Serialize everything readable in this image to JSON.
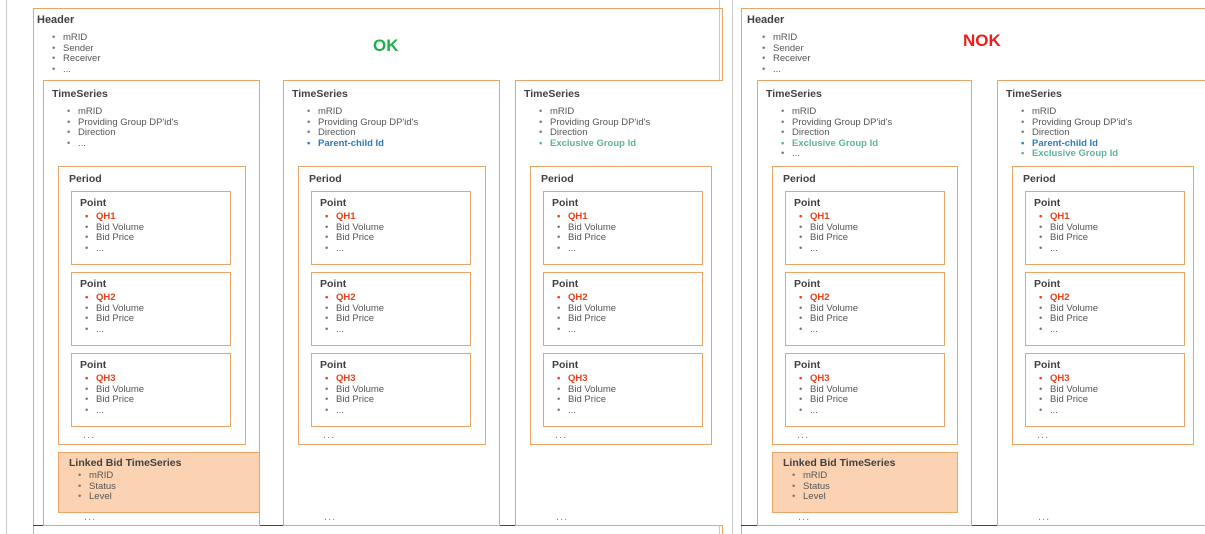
{
  "left": {
    "status": "OK",
    "status_color": "#1db04a",
    "header": {
      "title": "Header",
      "items": [
        "mRID",
        "Sender",
        "Receiver",
        "..."
      ]
    },
    "ts1": {
      "title": "TimeSeries",
      "items": [
        "mRID",
        "Providing Group DP'id's",
        "Direction",
        "..."
      ],
      "period_title": "Period",
      "points": [
        {
          "title": "Point",
          "items": [
            "QH1",
            "Bid Volume",
            "Bid Price",
            "..."
          ]
        },
        {
          "title": "Point",
          "items": [
            "QH2",
            "Bid Volume",
            "Bid Price",
            "..."
          ]
        },
        {
          "title": "Point",
          "items": [
            "QH3",
            "Bid Volume",
            "Bid Price",
            "..."
          ]
        }
      ],
      "points_more": "...",
      "linked": {
        "title": "Linked Bid TimeSeries",
        "items": [
          "mRID",
          "Status",
          "Level"
        ]
      },
      "more": "..."
    },
    "ts2": {
      "title": "TimeSeries",
      "items": [
        "mRID",
        "Providing Group DP'id's",
        "Direction",
        "Parent-child Id"
      ],
      "period_title": "Period",
      "points": [
        {
          "title": "Point",
          "items": [
            "QH1",
            "Bid Volume",
            "Bid Price",
            "..."
          ]
        },
        {
          "title": "Point",
          "items": [
            "QH2",
            "Bid Volume",
            "Bid Price",
            "..."
          ]
        },
        {
          "title": "Point",
          "items": [
            "QH3",
            "Bid Volume",
            "Bid Price",
            "..."
          ]
        }
      ],
      "points_more": "...",
      "more": "..."
    },
    "ts3": {
      "title": "TimeSeries",
      "items": [
        "mRID",
        "Providing Group DP'id's",
        "Direction",
        "Exclusive Group Id"
      ],
      "period_title": "Period",
      "points": [
        {
          "title": "Point",
          "items": [
            "QH1",
            "Bid Volume",
            "Bid Price",
            "..."
          ]
        },
        {
          "title": "Point",
          "items": [
            "QH2",
            "Bid Volume",
            "Bid Price",
            "..."
          ]
        },
        {
          "title": "Point",
          "items": [
            "QH3",
            "Bid Volume",
            "Bid Price",
            "..."
          ]
        }
      ],
      "points_more": "...",
      "more": "..."
    }
  },
  "right": {
    "status": "NOK",
    "status_color": "#ee1c1c",
    "header": {
      "title": "Header",
      "items": [
        "mRID",
        "Sender",
        "Receiver",
        "..."
      ]
    },
    "ts1": {
      "title": "TimeSeries",
      "items": [
        "mRID",
        "Providing Group DP'id's",
        "Direction",
        "Exclusive Group Id",
        "..."
      ],
      "period_title": "Period",
      "points": [
        {
          "title": "Point",
          "items": [
            "QH1",
            "Bid Volume",
            "Bid Price",
            "..."
          ]
        },
        {
          "title": "Point",
          "items": [
            "QH2",
            "Bid Volume",
            "Bid Price",
            "..."
          ]
        },
        {
          "title": "Point",
          "items": [
            "QH3",
            "Bid Volume",
            "Bid Price",
            "..."
          ]
        }
      ],
      "points_more": "...",
      "linked": {
        "title": "Linked Bid TimeSeries",
        "items": [
          "mRID",
          "Status",
          "Level"
        ]
      },
      "more": "..."
    },
    "ts2": {
      "title": "TimeSeries",
      "items": [
        "mRID",
        "Providing Group DP'id's",
        "Direction",
        "Parent-child Id",
        "Exclusive Group Id"
      ],
      "period_title": "Period",
      "points": [
        {
          "title": "Point",
          "items": [
            "QH1",
            "Bid Volume",
            "Bid Price",
            "..."
          ]
        },
        {
          "title": "Point",
          "items": [
            "QH2",
            "Bid Volume",
            "Bid Price",
            "..."
          ]
        },
        {
          "title": "Point",
          "items": [
            "QH3",
            "Bid Volume",
            "Bid Price",
            "..."
          ]
        }
      ],
      "points_more": "...",
      "more": "..."
    }
  },
  "colors": {
    "orange_border": "#e8a66a",
    "linked_fill": "#fbd3b3",
    "qh_red": "#e8401a",
    "parent_child_blue": "#2c7bbf",
    "exclusive_green": "#5eb49b"
  }
}
